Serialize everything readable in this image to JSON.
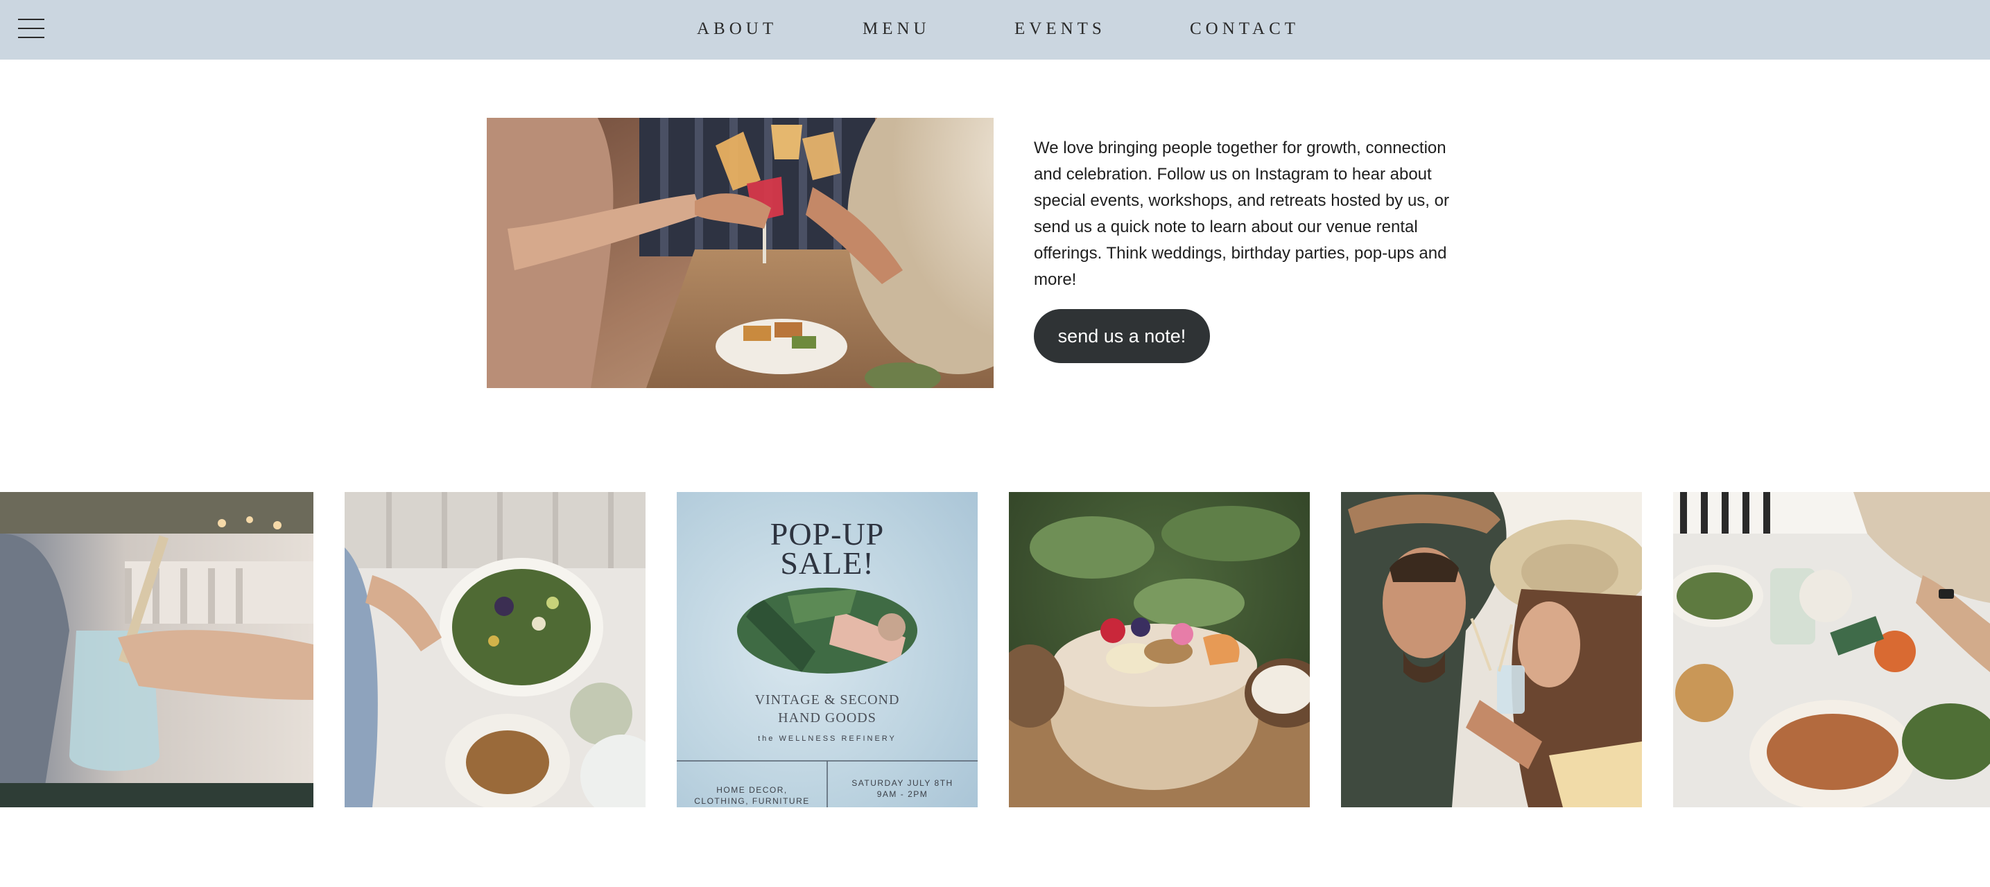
{
  "header": {
    "menu_icon": "hamburger-menu-icon",
    "nav": [
      {
        "label": "ABOUT"
      },
      {
        "label": "MENU"
      },
      {
        "label": "EVENTS"
      },
      {
        "label": "CONTACT"
      }
    ],
    "background": "#cbd6e0"
  },
  "hero": {
    "body": "We love bringing people together for growth, connection and celebration. Follow us on Instagram to hear about special events, workshops, and retreats hosted by us, or send us a quick note to learn about our venue rental offerings. Think weddings, birthday parties, pop-ups and more!",
    "cta_label": "send us a note!",
    "cta_color": "#2f3335"
  },
  "gallery": {
    "poster": {
      "title_line1": "POP-UP",
      "title_line2": "SALE!",
      "subtitle_line1": "VINTAGE & SECOND",
      "subtitle_line2": "HAND GOODS",
      "brand": "the WELLNESS REFINERY",
      "foot_left_line1": "HOME DECOR,",
      "foot_left_line2": "CLOTHING, FURNITURE",
      "foot_right_line1": "SATURDAY JULY 8TH",
      "foot_right_line2": "9AM - 2PM"
    }
  }
}
